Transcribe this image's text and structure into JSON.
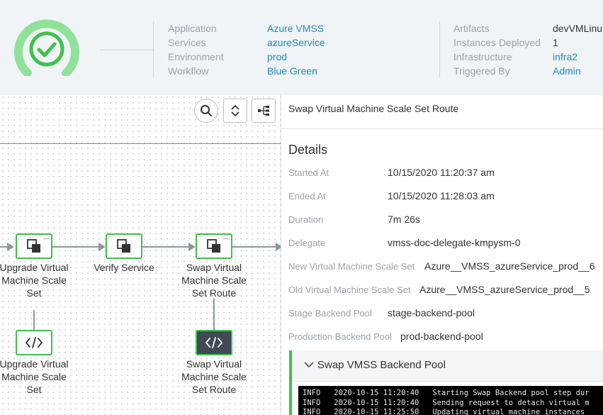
{
  "header": {
    "meta_left": [
      {
        "label": "Application",
        "value": "Azure VMSS"
      },
      {
        "label": "Services",
        "value": "azureService"
      },
      {
        "label": "Environment",
        "value": "prod"
      },
      {
        "label": "Workflow",
        "value": "Blue Green"
      }
    ],
    "meta_right": [
      {
        "label": "Artifacts",
        "value": "devVMLinu"
      },
      {
        "label": "Instances Deployed",
        "value": "1"
      },
      {
        "label": "Infrastructure",
        "value": "infra2"
      },
      {
        "label": "Triggered By",
        "value": "Admin"
      }
    ],
    "status_color": "#3ec24b"
  },
  "graph": {
    "toolbar_icons": [
      "search-icon",
      "expand-collapse-icon",
      "layout-icon"
    ],
    "nodes": [
      {
        "label": "Upgrade Virtual Machine Scale Set",
        "icon": "stack-icon"
      },
      {
        "label": "Verify Service",
        "icon": "stack-icon"
      },
      {
        "label": "Swap Virtual Machine Scale Set Route",
        "icon": "stack-icon"
      },
      {
        "label": "Upgrade Virtual Machine Scale Set",
        "icon": "code-icon"
      },
      {
        "label": "Swap Virtual Machine Scale Set Route",
        "icon": "code-icon"
      }
    ]
  },
  "panel": {
    "title": "Swap Virtual Machine Scale Set Route",
    "details_heading": "Details",
    "rows": [
      {
        "label": "Started At",
        "value": "10/15/2020 11:20:37 am"
      },
      {
        "label": "Ended At",
        "value": "10/15/2020 11:28:03 am"
      },
      {
        "label": "Duration",
        "value": "7m 26s"
      },
      {
        "label": "Delegate",
        "value": "vmss-doc-delegate-kmpysm-0"
      },
      {
        "label": "New Virtual Machine Scale Set",
        "value": "Azure__VMSS_azureService_prod__6"
      },
      {
        "label": "Old Virtual Machine Scale Set",
        "value": "Azure__VMSS_azureService_prod__5"
      },
      {
        "label": "Stage Backend Pool",
        "value": "stage-backend-pool"
      },
      {
        "label": "Production Backend Pool",
        "value": "prod-backend-pool"
      }
    ],
    "section": {
      "title": "Swap VMSS Backend Pool",
      "log_lines": [
        "INFO   2020-10-15 11:20:40   Starting Swap Backend pool step dur",
        "INFO   2020-10-15 11:20:40   Sending request to detach virtual m",
        "INFO   2020-10-15 11:25:50   Updating virtual machine instances"
      ]
    }
  }
}
